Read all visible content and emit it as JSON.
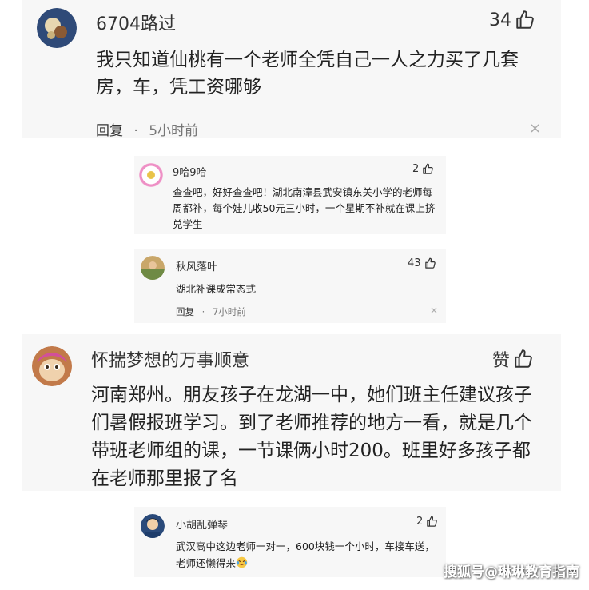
{
  "comments": [
    {
      "user": "6704路过",
      "likes": "34",
      "text": "我只知道仙桃有一个老师全凭自己一人之力买了几套房，车，凭工资哪够",
      "reply_label": "回复",
      "time": "5小时前",
      "replies": [
        {
          "user": "9哈9哈",
          "likes": "2",
          "text": "查查吧，好好查查吧！湖北南漳县武安镇东关小学的老师每周都补，每个娃儿收50元三小时，一个星期不补就在课上挤兑学生"
        },
        {
          "user": "秋风落叶",
          "likes": "43",
          "text": "湖北补课成常态式",
          "reply_label": "回复",
          "time": "7小时前"
        }
      ]
    },
    {
      "user": "怀揣梦想的万事顺意",
      "likes": "赞",
      "text": "河南郑州。朋友孩子在龙湖一中，她们班主任建议孩子们暑假报班学习。到了老师推荐的地方一看，就是几个带班老师组的课，一节课俩小时200。班里好多孩子都在老师那里报了名",
      "replies": [
        {
          "user": "小胡乱弹琴",
          "likes": "2",
          "text": "武汉高中这边老师一对一，600块钱一个小时，车接车送，老师还懒得来"
        }
      ]
    }
  ],
  "separator": "·",
  "close_glyph": "×",
  "watermark": "搜狐号@琳琳教育指南",
  "colors": {
    "card_bg": "#f7f7f7",
    "meta": "#777777",
    "text": "#222222"
  }
}
